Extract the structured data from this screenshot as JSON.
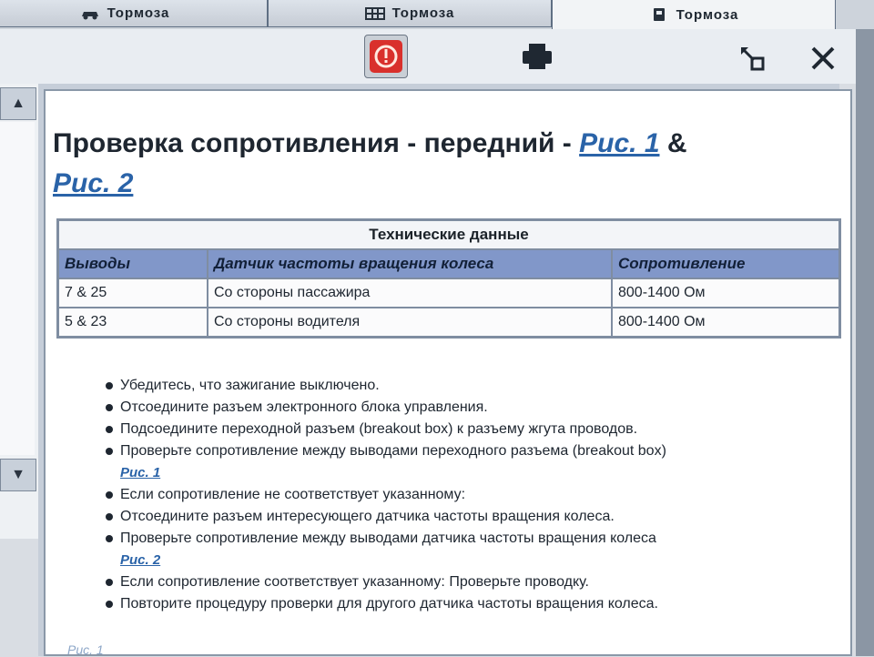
{
  "tabs": [
    {
      "label": "Тормоза",
      "icon": "car-icon"
    },
    {
      "label": "Тормоза",
      "icon": "grid-icon"
    },
    {
      "label": "Тормоза",
      "icon": "module-icon"
    }
  ],
  "toolbar": {
    "alert_icon": "alert-icon",
    "print_icon": "printer-icon",
    "resize_icon": "resize-icon",
    "close_icon": "close-icon"
  },
  "title": {
    "text": "Проверка сопротивления - передний - ",
    "link1": "Рис. 1",
    "amp": " & ",
    "link2": "Рис. 2"
  },
  "spec_table": {
    "caption": "Технические данные",
    "headers": [
      "Выводы",
      "Датчик частоты вращения колеса",
      "Сопротивление"
    ],
    "rows": [
      [
        "7 & 25",
        "Со стороны пассажира",
        "800-1400 Ом"
      ],
      [
        "5 & 23",
        "Со стороны водителя",
        "800-1400 Ом"
      ]
    ]
  },
  "steps": [
    {
      "text": "Убедитесь, что зажигание выключено."
    },
    {
      "text": "Отсоедините разъем электронного блока управления."
    },
    {
      "text": "Подсоедините переходной разъем (breakout box) к разъему жгута проводов."
    },
    {
      "text": "Проверьте сопротивление между выводами переходного разъема (breakout box)",
      "link": "Рис. 1"
    },
    {
      "text": "Если сопротивление не соответствует указанному:"
    },
    {
      "text": "Отсоедините разъем интересующего датчика частоты вращения колеса."
    },
    {
      "text": "Проверьте сопротивление между выводами датчика частоты вращения колеса",
      "link": "Рис. 2"
    },
    {
      "text": "Если сопротивление соответствует указанному: Проверьте проводку."
    },
    {
      "text": "Повторите процедуру проверки для другого датчика частоты вращения колеса."
    }
  ],
  "footer_link": "Рис. 1",
  "colors": {
    "link": "#2a63a8",
    "header_row": "#8197c9",
    "alert": "#d9302c"
  }
}
